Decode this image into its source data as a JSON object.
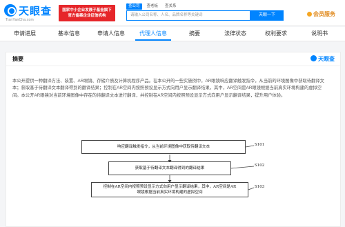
{
  "header": {
    "logo_text": "天眼查",
    "logo_sub": "TianYanCha.com",
    "promo_line1": "国家中小企业发展子基金旗下",
    "promo_line2": "官方备案企业征信机构",
    "search_tabs": [
      "查公司",
      "查老板",
      "查关系"
    ],
    "search_placeholder": "请输入公司名称、人名、品牌名称等关键词",
    "search_button": "天眼一下",
    "vip_label": "会员服务"
  },
  "nav": {
    "items": [
      "申请进展",
      "基本信息",
      "申请人信息",
      "代理人信息",
      "摘要",
      "法律状态",
      "权利要求",
      "说明书"
    ],
    "active_index": 3
  },
  "abstract": {
    "title": "摘要",
    "watermark": "天眼查",
    "text": "本公开提供一种翻译方法、装置、AR眼镜、存储介质及计算机程序产品。在本公开的一些实施例中，AR眼镜响应翻译触发指令，从当前的环境图像中获取待翻译文本；获取基于待翻译文本翻译得到的翻译结果；控制在AR空间内按照预设显示方式向用户显示翻译结果，其中，AR空间是AR眼镜根据当前真实环境构建的虚拟空间。本公开AR眼镜对当前环境图像中存在的待翻译文本进行翻译，并控制在AR空间内按照预设显示方式向用户显示翻译结果，提升用户体验。"
  },
  "flowchart": {
    "steps": [
      {
        "text": "响应翻译触发指令，从当前环境图像中获取待翻译文本",
        "code": "S101"
      },
      {
        "text": "获取基于待翻译文本翻译得到的翻译结果",
        "code": "S102"
      },
      {
        "text_line1": "控制在AR空间内按照预设显示方式向用户显示翻译结果，其中，AR空间是AR",
        "text_line2": "眼镜根据当前真实环境构建的虚拟空间",
        "code": "S103"
      }
    ]
  }
}
